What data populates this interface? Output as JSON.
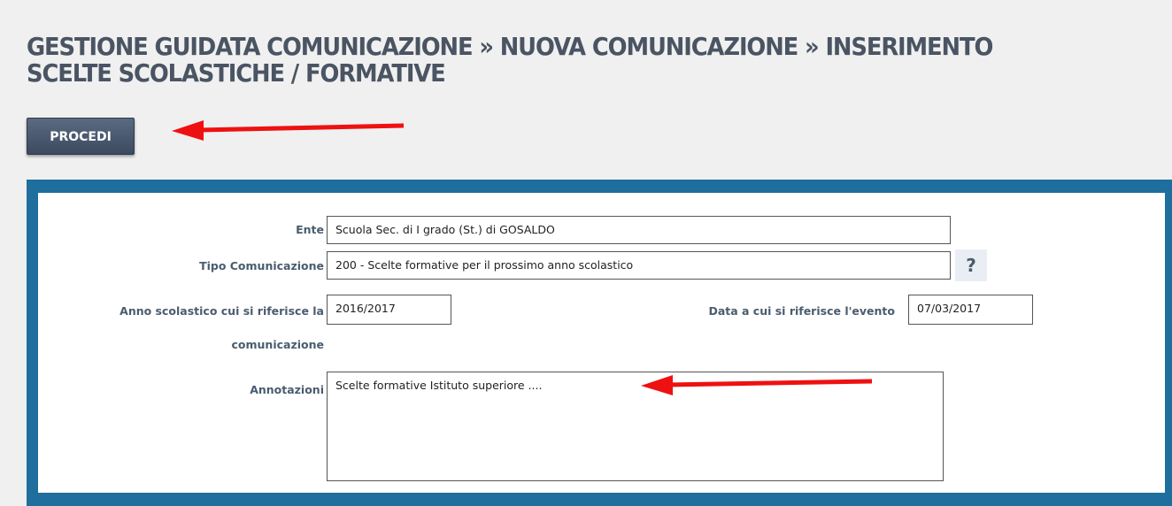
{
  "header": {
    "title": "GESTIONE GUIDATA COMUNICAZIONE » NUOVA COMUNICAZIONE » INSERIMENTO SCELTE SCOLASTICHE / FORMATIVE"
  },
  "toolbar": {
    "proceed_label": "PROCEDI"
  },
  "form": {
    "ente": {
      "label": "Ente",
      "value": "Scuola Sec. di I grado  (St.)   di GOSALDO"
    },
    "tipo_comunicazione": {
      "label": "Tipo Comunicazione",
      "value": "200 - Scelte formative per il prossimo anno scolastico",
      "help_label": "?"
    },
    "anno_scolastico": {
      "label_line1": "Anno scolastico cui si riferisce la",
      "label_line2": "comunicazione",
      "value": "2016/2017"
    },
    "data_evento": {
      "label": "Data a cui si riferisce l'evento",
      "value": "07/03/2017"
    },
    "annotazioni": {
      "label": "Annotazioni",
      "value": "Scelte formative Istituto superiore ...."
    }
  },
  "annotations": {
    "arrow_color": "#ee1111"
  },
  "colors": {
    "panel_border": "#1e6e9e",
    "button_bg": "#4a5a70",
    "title_text": "#4a5463"
  }
}
